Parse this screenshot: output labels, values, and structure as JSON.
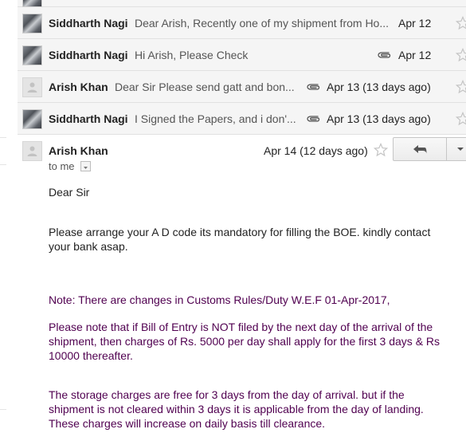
{
  "thread": {
    "collapsed": [
      {
        "sender": "",
        "snippet": "",
        "date": "",
        "has_attachment": false,
        "avatar": "photo"
      },
      {
        "sender": "Siddharth Nagi",
        "snippet": "Dear Arish, Recently one of my shipment from Ho...",
        "date": "Apr 12",
        "has_attachment": false,
        "avatar": "photo"
      },
      {
        "sender": "Siddharth Nagi",
        "snippet": "Hi Arish, Please Check",
        "date": "Apr 12",
        "has_attachment": true,
        "avatar": "photo"
      },
      {
        "sender": "Arish Khan",
        "snippet": "Dear Sir Please send gatt and bon...",
        "date": "Apr 13 (13 days ago)",
        "has_attachment": true,
        "avatar": "generic"
      },
      {
        "sender": "Siddharth Nagi",
        "snippet": "I Signed the Papers, and i don'...",
        "date": "Apr 13 (13 days ago)",
        "has_attachment": true,
        "avatar": "photo"
      }
    ],
    "open_message": {
      "sender": "Arish Khan",
      "date": "Apr 14 (12 days ago)",
      "recipient": "to me",
      "greeting": "Dear Sir",
      "paragraph1": "Please arrange your A D code its mandatory for filling the BOE. kindly contact your bank asap.",
      "note": "Note: There are changes in Customs Rules/Duty W.E.F 01-Apr-2017,",
      "paragraph2": "Please note that if Bill of Entry is NOT filed by the next day of the arrival of the shipment, then charges of Rs. 5000 per day shall apply for the first 3 days & Rs 10000 thereafter.",
      "paragraph3": "The storage charges are free for 3 days from the day of arrival. but if the shipment is not cleared within 3 days it is applicable from the day of landing. These charges will increase on daily basis till clearance."
    }
  },
  "icons": {
    "star": "star-outline-icon",
    "attachment": "paperclip-icon",
    "reply": "reply-arrow-icon",
    "more": "caret-down-icon"
  },
  "colors": {
    "collapsed_bg": "#f5f5f5",
    "quoted_text": "#500050",
    "body_text": "#222222"
  }
}
